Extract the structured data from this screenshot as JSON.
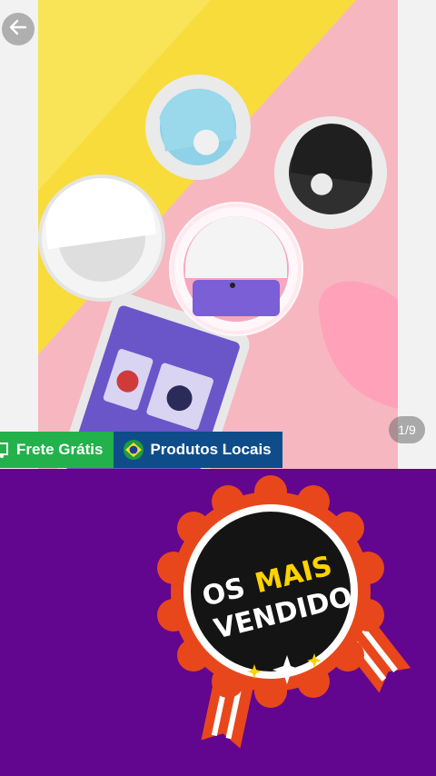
{
  "navigation": {
    "back_icon": "arrow-left-icon"
  },
  "gallery": {
    "counter": "1/9",
    "tags": {
      "free_shipping": "Frete Grátis",
      "free_shipping_icon": "truck-icon",
      "local_products": "Produtos Locais",
      "local_products_icon": "brazil-flag-icon"
    }
  },
  "promo": {
    "badge_line1_white": "OS",
    "badge_line1_yellow": "MAIS",
    "badge_line2": "VENDIDO",
    "colors": {
      "background": "#62068f",
      "ribbon": "#e8471c",
      "accent": "#ffd200"
    }
  }
}
